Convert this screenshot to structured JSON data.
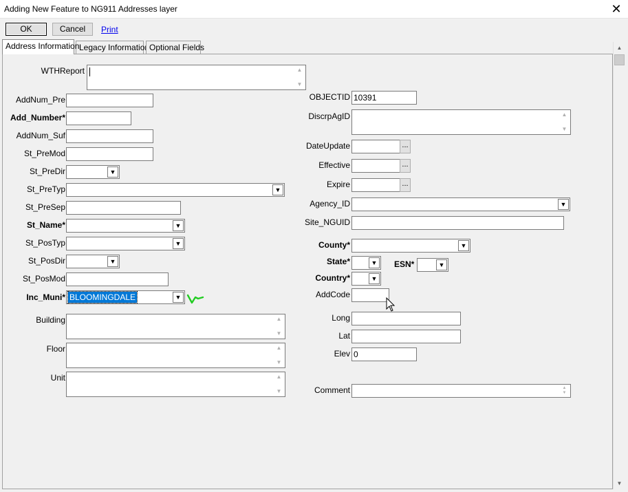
{
  "window": {
    "title": "Adding New Feature to NG911 Addresses layer",
    "close_glyph": "✕"
  },
  "toolbar": {
    "ok_label": "OK",
    "cancel_label": "Cancel",
    "print_label": "Print"
  },
  "tabs": [
    {
      "label": "Address Information",
      "active": true
    },
    {
      "label": "Legacy Information",
      "active": false
    },
    {
      "label": "Optional Fields",
      "active": false
    }
  ],
  "left_fields": {
    "wthreport": {
      "label": "WTHReport",
      "value": ""
    },
    "addnum_pre": {
      "label": "AddNum_Pre",
      "value": ""
    },
    "add_number": {
      "label": "Add_Number*",
      "value": ""
    },
    "addnum_suf": {
      "label": "AddNum_Suf",
      "value": ""
    },
    "st_premod": {
      "label": "St_PreMod",
      "value": ""
    },
    "st_predir": {
      "label": "St_PreDir",
      "value": ""
    },
    "st_pretyp": {
      "label": "St_PreTyp",
      "value": ""
    },
    "st_presep": {
      "label": "St_PreSep",
      "value": ""
    },
    "st_name": {
      "label": "St_Name*",
      "value": ""
    },
    "st_postyp": {
      "label": "St_PosTyp",
      "value": ""
    },
    "st_posdir": {
      "label": "St_PosDir",
      "value": ""
    },
    "st_posmod": {
      "label": "St_PosMod",
      "value": ""
    },
    "inc_muni": {
      "label": "Inc_Muni*",
      "value": "BLOOMINGDALE"
    },
    "building": {
      "label": "Building",
      "value": ""
    },
    "floor": {
      "label": "Floor",
      "value": ""
    },
    "unit": {
      "label": "Unit",
      "value": ""
    }
  },
  "right_fields": {
    "objectid": {
      "label": "OBJECTID",
      "value": "10391"
    },
    "discrpagid": {
      "label": "DiscrpAgID",
      "value": ""
    },
    "dateupdate": {
      "label": "DateUpdate",
      "value": "",
      "button": "..."
    },
    "effective": {
      "label": "Effective",
      "value": "",
      "button": "..."
    },
    "expire": {
      "label": "Expire",
      "value": "",
      "button": "..."
    },
    "agency_id": {
      "label": "Agency_ID",
      "value": ""
    },
    "site_nguid": {
      "label": "Site_NGUID",
      "value": ""
    },
    "county": {
      "label": "County*",
      "value": ""
    },
    "state": {
      "label": "State*",
      "value": ""
    },
    "esn": {
      "label": "ESN*",
      "value": ""
    },
    "country": {
      "label": "Country*",
      "value": ""
    },
    "addcode": {
      "label": "AddCode",
      "value": ""
    },
    "long": {
      "label": "Long",
      "value": ""
    },
    "lat": {
      "label": "Lat",
      "value": ""
    },
    "elev": {
      "label": "Elev",
      "value": "0"
    },
    "comment": {
      "label": "Comment",
      "value": ""
    }
  },
  "glyphs": {
    "up": "▲",
    "down": "▼",
    "combo": "▼"
  },
  "colors": {
    "selection": "#0078d7",
    "checkmark": "#22cc22",
    "link": "#0000ee"
  }
}
